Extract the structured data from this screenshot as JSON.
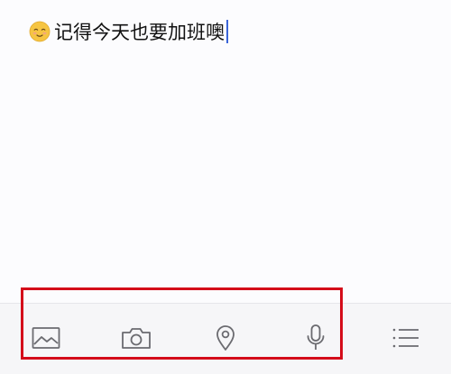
{
  "editor": {
    "content": "记得今天也要加班噢",
    "emoji": "relieved-face-emoji"
  },
  "toolbar": {
    "items": [
      {
        "name": "image",
        "icon": "image-icon"
      },
      {
        "name": "camera",
        "icon": "camera-icon"
      },
      {
        "name": "location",
        "icon": "location-pin-icon"
      },
      {
        "name": "voice",
        "icon": "microphone-icon"
      },
      {
        "name": "list",
        "icon": "list-icon"
      }
    ]
  },
  "colors": {
    "icon_stroke": "#6b6b70",
    "caret": "#3a64d8",
    "highlight": "#d40c1a",
    "toolbar_bg": "#f6f6f8"
  }
}
